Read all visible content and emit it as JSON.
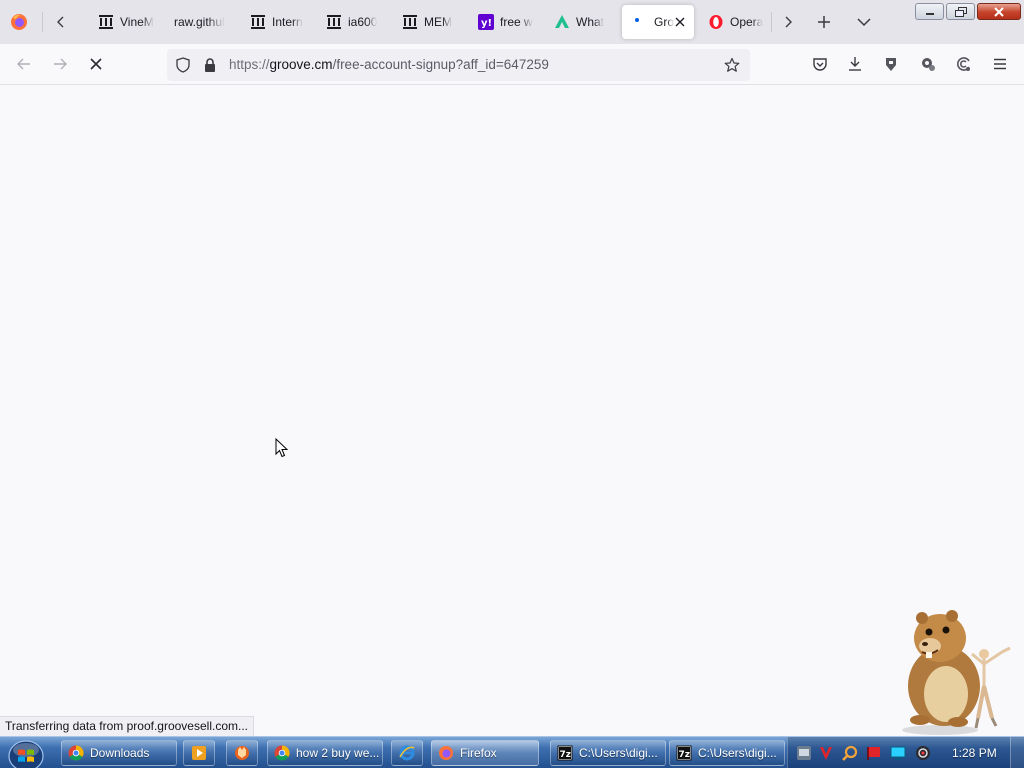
{
  "browser": {
    "tabs": [
      {
        "label": "VineM",
        "favicon": "archive-icon",
        "active": false
      },
      {
        "label": "raw.githul",
        "favicon": "none",
        "active": false
      },
      {
        "label": "Intern",
        "favicon": "archive-icon",
        "active": false
      },
      {
        "label": "ia600",
        "favicon": "archive-icon",
        "active": false
      },
      {
        "label": "MEM",
        "favicon": "archive-icon",
        "active": false
      },
      {
        "label": "free w",
        "favicon": "yahoo-icon",
        "active": false
      },
      {
        "label": "What",
        "favicon": "triangle-logo-icon",
        "active": false
      },
      {
        "label": "Gro",
        "favicon": "loading-dot-icon",
        "active": true
      },
      {
        "label": "Opera",
        "favicon": "opera-icon",
        "active": false
      }
    ],
    "url": {
      "protocol": "https://",
      "host": "groove.cm",
      "path": "/free-account-signup?aff_id=647259"
    },
    "status_text": "Transferring data from proof.groovesell.com..."
  },
  "taskbar": {
    "buttons": [
      {
        "label": "Downloads",
        "icon": "chrome-icon"
      },
      {
        "label": "",
        "icon": "media-player-icon"
      },
      {
        "label": "",
        "icon": "wolf-app-icon"
      },
      {
        "label": "how 2 buy we...",
        "icon": "chrome-icon"
      },
      {
        "label": "",
        "icon": "internet-explorer-icon"
      },
      {
        "label": "Firefox",
        "icon": "firefox-icon"
      },
      {
        "label": "C:\\Users\\digi...",
        "icon": "7zip-icon"
      },
      {
        "label": "C:\\Users\\digi...",
        "icon": "7zip-icon"
      }
    ],
    "clock": "1:28 PM"
  },
  "colors": {
    "accent": "#0060df",
    "tab_strip": "#e4e4ea",
    "content_bg": "#f9f9fb",
    "taskbar": "#23508f"
  }
}
